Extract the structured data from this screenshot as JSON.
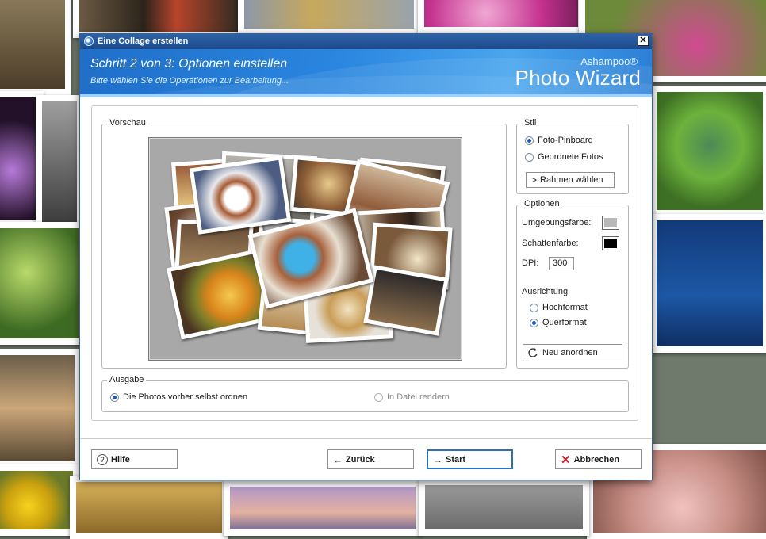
{
  "window": {
    "title": "Eine Collage erstellen",
    "close_glyph": "✕"
  },
  "banner": {
    "step": "Schritt 2 von 3: Optionen einstellen",
    "subtitle": "Bitte wählen Sie die Operationen zur Bearbeitung...",
    "brand_top": "Ashampoo®",
    "brand_main": "Photo Wizard"
  },
  "preview": {
    "legend": "Vorschau"
  },
  "style": {
    "legend": "Stil",
    "options": [
      {
        "label": "Foto-Pinboard",
        "checked": true
      },
      {
        "label": "Geordnete Fotos",
        "checked": false
      }
    ],
    "frame_button": "Rahmen wählen"
  },
  "options": {
    "legend": "Optionen",
    "surrounding_color_label": "Umgebungsfarbe:",
    "surrounding_color": "#b8b8b8",
    "shadow_color_label": "Schattenfarbe:",
    "shadow_color": "#000000",
    "dpi_label": "DPI:",
    "dpi_value": "300",
    "orientation_label": "Ausrichtung",
    "orientation": [
      {
        "label": "Hochformat",
        "checked": false
      },
      {
        "label": "Querformat",
        "checked": true
      }
    ],
    "rearrange_button": "Neu anordnen"
  },
  "output": {
    "legend": "Ausgabe",
    "options": [
      {
        "label": "Die Photos vorher selbst ordnen",
        "checked": true
      },
      {
        "label": "In Datei rendern",
        "checked": false
      }
    ]
  },
  "footer": {
    "help": "Hilfe",
    "back": "Zurück",
    "start": "Start",
    "cancel": "Abbrechen"
  },
  "colors": {
    "title_bar": "#1c4b8c",
    "banner": "#2a86df",
    "accent_border": "#2b6fb7",
    "cancel_icon": "#d0202a"
  }
}
